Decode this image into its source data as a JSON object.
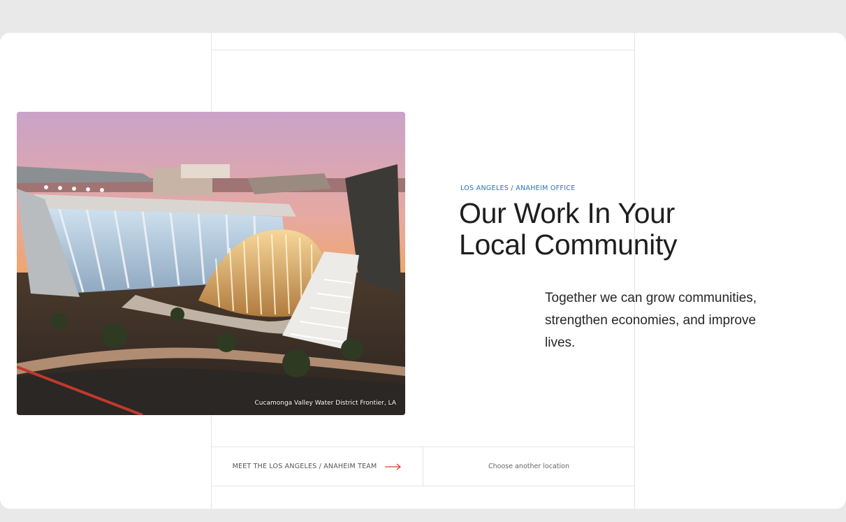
{
  "office": {
    "eyebrow": "LOS ANGELES / ANAHEIM OFFICE",
    "title_line1": "Our Work In Your",
    "title_line2": "Local Community",
    "body_line1": "Together we can grow communities,",
    "body_line2": "strengthen economies, and improve",
    "body_line3": "lives."
  },
  "photo": {
    "caption": "Cucamonga Valley Water District Frontier, LA"
  },
  "cta": {
    "team_label": "MEET THE LOS ANGELES / ANAHEIM TEAM",
    "other_label": "Choose another location",
    "arrow_icon": "arrow-right-icon"
  },
  "colors": {
    "accent_blue": "#2a6fc9",
    "arrow_red": "#d9432b"
  }
}
